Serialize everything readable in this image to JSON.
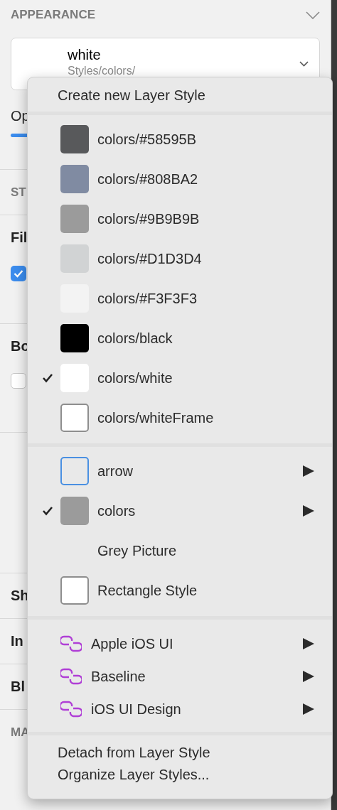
{
  "panel": {
    "title": "APPEARANCE",
    "style_picker": {
      "name": "white",
      "path": "Styles/colors/"
    },
    "sections": [
      {
        "kind": "opacity",
        "label": "Op"
      },
      {
        "kind": "header",
        "label": "ST"
      },
      {
        "kind": "fill",
        "label": "Fil",
        "checked": true
      },
      {
        "kind": "border",
        "label": "Bo",
        "checked": false
      },
      {
        "kind": "blank"
      },
      {
        "kind": "row",
        "label": "Sh"
      },
      {
        "kind": "row",
        "label": "In"
      },
      {
        "kind": "row",
        "label": "Bl"
      },
      {
        "kind": "header",
        "label": "MA"
      }
    ]
  },
  "menu": {
    "create_item": "Create new Layer Style",
    "styles": [
      {
        "kind": "swatch",
        "label": "colors/#58595B",
        "color": "#58595b",
        "checked": false
      },
      {
        "kind": "swatch",
        "label": "colors/#808BA2",
        "color": "#808ba2",
        "checked": false
      },
      {
        "kind": "swatch",
        "label": "colors/#9B9B9B",
        "color": "#9b9b9b",
        "checked": false
      },
      {
        "kind": "swatch",
        "label": "colors/#D1D3D4",
        "color": "#d1d3d4",
        "checked": false
      },
      {
        "kind": "swatch",
        "label": "colors/#F3F3F3",
        "color": "#f3f3f3",
        "checked": false
      },
      {
        "kind": "swatch",
        "label": "colors/black",
        "color": "#000000",
        "checked": false
      },
      {
        "kind": "swatch",
        "label": "colors/white",
        "color": "#ffffff",
        "checked": true
      },
      {
        "kind": "framed",
        "label": "colors/whiteFrame",
        "color": "#ffffff",
        "checked": false
      }
    ],
    "groups": [
      {
        "kind": "outline",
        "label": "arrow",
        "color": "#4a90e2",
        "checked": false,
        "submenu": true
      },
      {
        "kind": "swatch",
        "label": "colors",
        "color": "#9b9b9b",
        "checked": true,
        "submenu": true
      },
      {
        "kind": "plain",
        "label": "Grey Picture",
        "checked": false,
        "submenu": false
      },
      {
        "kind": "framed",
        "label": "Rectangle Style",
        "color": "#ffffff",
        "checked": false,
        "submenu": false
      }
    ],
    "libraries": [
      {
        "label": "Apple iOS UI",
        "submenu": true
      },
      {
        "label": "Baseline",
        "submenu": true
      },
      {
        "label": "iOS UI Design",
        "submenu": true
      }
    ],
    "footer_items": [
      "Detach from Layer Style",
      "Organize Layer Styles..."
    ]
  }
}
